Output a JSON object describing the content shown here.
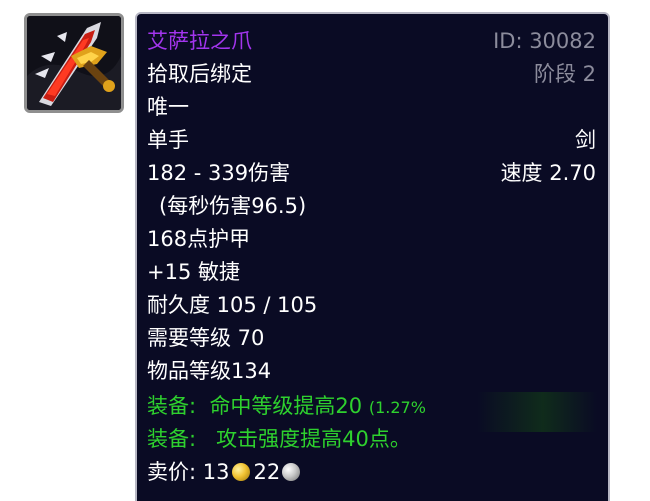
{
  "item": {
    "name": "艾萨拉之爪",
    "id_label": "ID: 30082",
    "binding": "拾取后绑定",
    "stage": "阶段 2",
    "unique": "唯一",
    "slot": "单手",
    "type": "剑",
    "damage": "182 - 339伤害",
    "speed": "速度 2.70",
    "dps": "(每秒伤害96.5)",
    "armor": "168点护甲",
    "agility": "+15 敏捷",
    "durability": "耐久度 105 / 105",
    "required_level": "需要等级 70",
    "item_level": "物品等级134",
    "equip1_prefix": "装备:",
    "equip1_text": "命中等级提高20",
    "equip1_extra": "(1.27%",
    "equip2_prefix": "装备:",
    "equip2_text": "攻击强度提高40点。",
    "sell_label": "卖价:",
    "sell_gold": "13",
    "sell_silver": "22"
  },
  "colors": {
    "name": "#a335ee",
    "muted": "#8c8c9c",
    "equip": "#2ed12e",
    "tooltip_bg": "#0a0b24",
    "border": "#b7b7c4"
  },
  "icons": {
    "item": "sword-item-icon",
    "gold": "gold-coin-icon",
    "silver": "silver-coin-icon"
  }
}
